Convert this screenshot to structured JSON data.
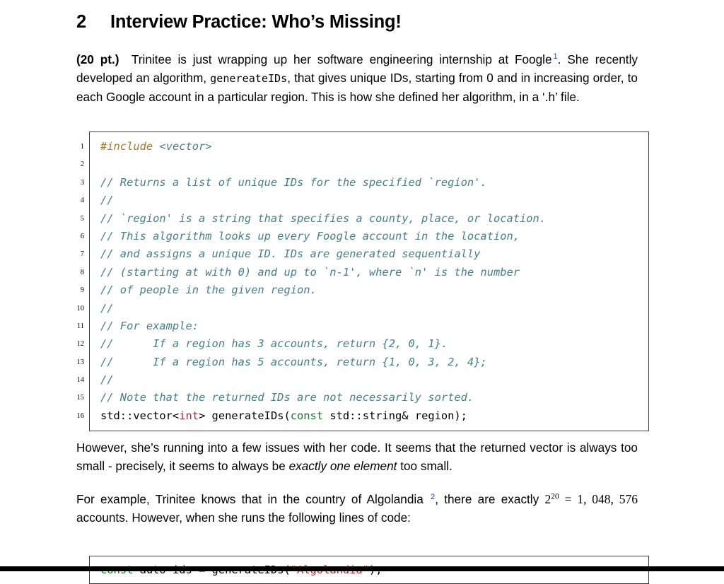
{
  "document": {
    "section": {
      "number": "2",
      "title": "Interview Practice: Who’s Missing!"
    },
    "paragraphs": {
      "intro": {
        "points_label": "(20 pt.)",
        "part1": "Trinitee is just wrapping up her software engineering internship at Foogle",
        "footnote1": "1",
        "part2": ". She recently developed an algorithm, ",
        "code_term": "genereateIDs",
        "part3": ", that gives unique IDs, starting from 0 and in increasing order, to each Google account in a particular region. This is how she defined her algorithm, in a ‘.h’ file."
      },
      "issues": {
        "part1": "However, she’s running into a few issues with her code. It seems that the returned vector is always too small - precisely, it seems to always be ",
        "emphasis": "exactly one element",
        "part2": " too small."
      },
      "example": {
        "part1": "For example, Trinitee knows that in the country of Algolandia",
        "footnote2": "2",
        "part2": ", there are exactly ",
        "math_base": "2",
        "math_exp": "20",
        "equals": " = ",
        "math_value": "1, 048, 576",
        "part3": " accounts. However, when she runs the following lines of code:"
      }
    },
    "code_listing_1": {
      "lines": [
        {
          "n": "1",
          "tokens": [
            {
              "t": "#include",
              "c": "pre"
            },
            {
              "t": " ",
              "c": "plain"
            },
            {
              "t": "<vector>",
              "c": "header"
            }
          ]
        },
        {
          "n": "2",
          "tokens": [
            {
              "t": "",
              "c": "plain"
            }
          ]
        },
        {
          "n": "3",
          "tokens": [
            {
              "t": "// Returns a list of unique IDs for the specified `region'.",
              "c": "comment"
            }
          ]
        },
        {
          "n": "4",
          "tokens": [
            {
              "t": "//",
              "c": "comment"
            }
          ]
        },
        {
          "n": "5",
          "tokens": [
            {
              "t": "// `region' is a string that specifies a county, place, or location.",
              "c": "comment"
            }
          ]
        },
        {
          "n": "6",
          "tokens": [
            {
              "t": "// This algorithm looks up every Foogle account in the location,",
              "c": "comment"
            }
          ]
        },
        {
          "n": "7",
          "tokens": [
            {
              "t": "// and assigns a unique ID. IDs are generated sequentially",
              "c": "comment"
            }
          ]
        },
        {
          "n": "8",
          "tokens": [
            {
              "t": "// (starting at with 0) and up to `n-1', where `n' is the number",
              "c": "comment"
            }
          ]
        },
        {
          "n": "9",
          "tokens": [
            {
              "t": "// of people in the given region.",
              "c": "comment"
            }
          ]
        },
        {
          "n": "10",
          "tokens": [
            {
              "t": "//",
              "c": "comment"
            }
          ]
        },
        {
          "n": "11",
          "tokens": [
            {
              "t": "// For example:",
              "c": "comment"
            }
          ]
        },
        {
          "n": "12",
          "tokens": [
            {
              "t": "//      If a region has 3 accounts, return {2, 0, 1}.",
              "c": "comment"
            }
          ]
        },
        {
          "n": "13",
          "tokens": [
            {
              "t": "//      If a region has 5 accounts, return {1, 0, 3, 2, 4};",
              "c": "comment"
            }
          ]
        },
        {
          "n": "14",
          "tokens": [
            {
              "t": "//",
              "c": "comment"
            }
          ]
        },
        {
          "n": "15",
          "tokens": [
            {
              "t": "// Note that the returned IDs are not necessarily sorted.",
              "c": "comment"
            }
          ]
        },
        {
          "n": "16",
          "tokens": [
            {
              "t": "std::vector<",
              "c": "plain"
            },
            {
              "t": "int",
              "c": "type"
            },
            {
              "t": "> generateIDs(",
              "c": "plain"
            },
            {
              "t": "const",
              "c": "kw"
            },
            {
              "t": " std::string& region);",
              "c": "plain"
            }
          ]
        }
      ]
    },
    "code_listing_2": {
      "lines": [
        {
          "n": "1",
          "tokens": [
            {
              "t": "const",
              "c": "kw"
            },
            {
              "t": " auto ids = generateIDs(",
              "c": "plain"
            },
            {
              "t": "\"Algolandia\"",
              "c": "str"
            },
            {
              "t": ");",
              "c": "plain"
            }
          ]
        }
      ]
    }
  }
}
